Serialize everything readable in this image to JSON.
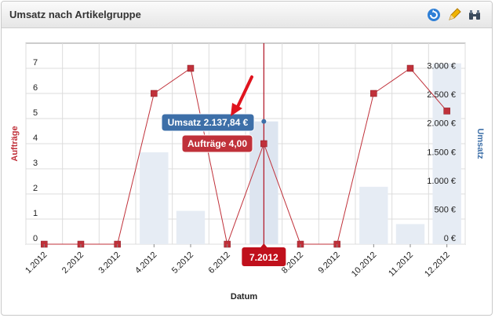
{
  "widget": {
    "title": "Umsatz nach Artikelgruppe",
    "icons": [
      "refresh-icon",
      "edit-pencil-icon",
      "binoculars-icon"
    ]
  },
  "chart_data": {
    "type": "bar+line",
    "categories": [
      "1.2012",
      "2.2012",
      "3.2012",
      "4.2012",
      "5.2012",
      "6.2012",
      "7.2012",
      "8.2012",
      "9.2012",
      "10.2012",
      "11.2012",
      "12.2012"
    ],
    "series": [
      {
        "name": "Aufträge",
        "type": "line",
        "axis": "left",
        "values": [
          0,
          0,
          0,
          6,
          7,
          0,
          4,
          0,
          0,
          6,
          7,
          5.3
        ]
      },
      {
        "name": "Umsatz",
        "type": "bar",
        "axis": "right",
        "values": [
          0,
          0,
          0,
          1600,
          580,
          0,
          2137.84,
          0,
          0,
          1000,
          350,
          3150
        ]
      }
    ],
    "xlabel": "Datum",
    "ylabel_left": "Aufträge",
    "ylabel_right": "Umsatz",
    "yleft_ticks": [
      "0",
      "1",
      "2",
      "3",
      "4",
      "5",
      "6",
      "7"
    ],
    "yright_ticks": [
      "0 €",
      "500 €",
      "1.000 €",
      "1.500 €",
      "2.000 €",
      "2.500 €",
      "3.000 €"
    ],
    "yleft_lim": [
      0,
      8
    ],
    "yright_lim": [
      0,
      3500
    ],
    "grid": true,
    "highlight_index": 6,
    "tooltips": {
      "umsatz": "Umsatz 2.137,84 €",
      "auftraege": "Aufträge 4,00",
      "category": "7.2012"
    },
    "colors": {
      "line": "#c0313a",
      "bar": "#e6ecf4",
      "tooltip_blue": "#3d6fa8",
      "tooltip_red": "#c0313a",
      "right_axis": "#3d6fa8",
      "left_axis": "#c0313a"
    }
  }
}
